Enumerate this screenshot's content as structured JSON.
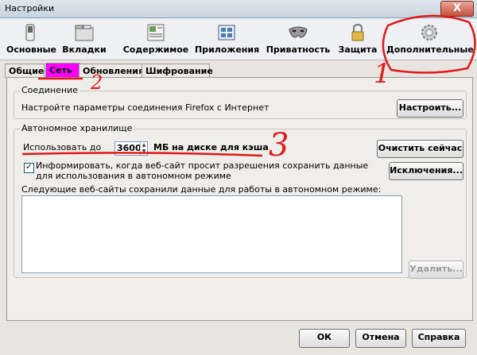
{
  "window": {
    "title": "Настройки",
    "close_glyph": "X"
  },
  "toolbar": {
    "items": [
      {
        "label": "Основные",
        "icon": "switch-icon"
      },
      {
        "label": "Вкладки",
        "icon": "tabs-icon"
      },
      {
        "label": "Содержимое",
        "icon": "content-icon"
      },
      {
        "label": "Приложения",
        "icon": "applications-icon"
      },
      {
        "label": "Приватность",
        "icon": "privacy-mask-icon"
      },
      {
        "label": "Защита",
        "icon": "padlock-icon"
      },
      {
        "label": "Дополнительные",
        "icon": "gear-icon"
      }
    ],
    "selected": "Дополнительные"
  },
  "tabs": [
    {
      "label": "Общие"
    },
    {
      "label": "Сеть"
    },
    {
      "label": "Обновления"
    },
    {
      "label": "Шифрование"
    }
  ],
  "connection": {
    "legend": "Соединение",
    "text": "Настройте параметры соединения Firefox с Интернет",
    "button": "Настроить..."
  },
  "storage": {
    "legend": "Автономное хранилище",
    "use_prefix": "Использовать до",
    "cache_size": "3600",
    "use_suffix": "МБ на диске для кэша",
    "clear_button": "Очистить сейчас",
    "notify_line1": "Информировать, когда веб-сайт просит разрешения сохранить данные",
    "notify_line2": "для использования в автономном режиме",
    "notify_checked": true,
    "check_glyph": "✓",
    "exceptions_button": "Исключения...",
    "list_label": "Следующие веб-сайты сохранили данные для работы в автономном режиме:",
    "delete_button": "Удалить..."
  },
  "footer": {
    "ok": "ОК",
    "cancel": "Отмена",
    "help": "Справка"
  },
  "annotations": {
    "n1": "1",
    "n2": "2",
    "n3": "3",
    "color": "#e01818"
  },
  "colors": {
    "active_tab": "#ff00ff",
    "annotation_red": "#e01818"
  }
}
